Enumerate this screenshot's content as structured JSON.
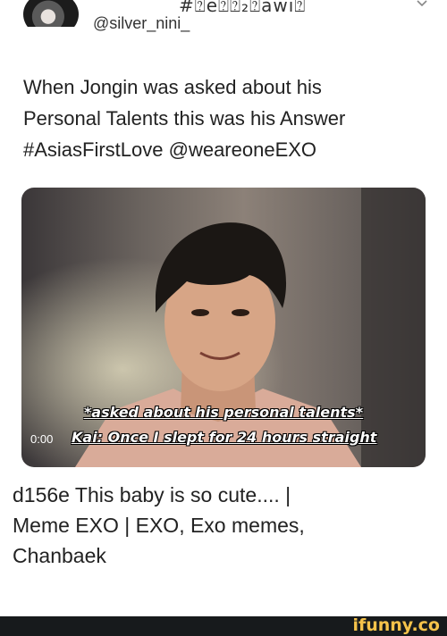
{
  "header": {
    "garbled_text": "#⍰e⍰⍰₂⍰awi⍰",
    "handle": "@silver_nini_"
  },
  "tweet": {
    "lines": [
      "When Jongin was asked about his",
      "Personal Talents this was his Answer",
      "#AsiasFirstLove @weareoneEXO"
    ]
  },
  "image": {
    "caption_top": "*asked about his personal talents*",
    "caption_bottom": "Kai: Once I slept for 24 hours straight",
    "timecode": "0:00"
  },
  "page": {
    "title_lines": [
      "d156e This baby is so cute.... |",
      "Meme EXO | EXO, Exo memes,",
      "Chanbaek"
    ]
  },
  "footer": {
    "logo_text": "ifunny.co"
  },
  "colors": {
    "footer_bg": "#171a1c",
    "logo": "#f6c34a"
  }
}
